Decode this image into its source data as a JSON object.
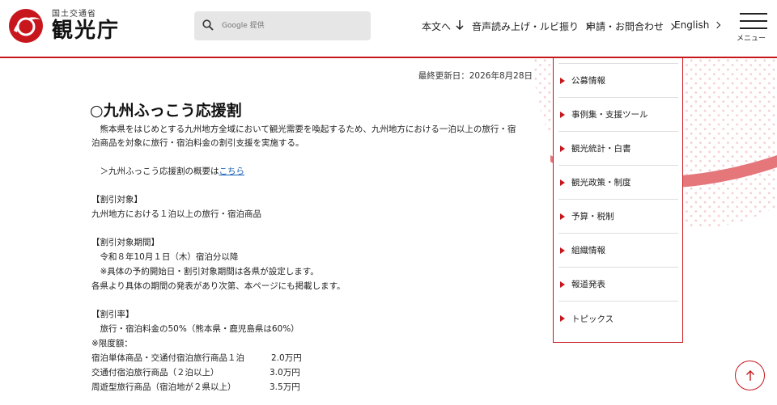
{
  "header": {
    "ministry": "国土交通省",
    "agency": "観光庁",
    "search_placeholder": "Google 提供",
    "nav": [
      {
        "label": "本文へ",
        "icon": "arrow-down-icon"
      },
      {
        "label": "音声読み上げ・ルビ振り",
        "icon": "chevron-right-icon"
      },
      {
        "label": "申請・お問合わせ",
        "icon": "chevron-right-icon"
      },
      {
        "label": "English",
        "icon": "chevron-right-icon"
      }
    ],
    "menu_label": "メニュー"
  },
  "main": {
    "updated": "最終更新日：2026年8月28日",
    "title": "○九州ふっこう応援割",
    "intro_line1": "　熊本県をはじめとする九州地方全域において観光需要を喚起するため、九州地方における一泊以上の旅行・宿",
    "intro_line2": "泊商品を対象に旅行・宿泊料金の割引支援を実施する。",
    "overview_prefix": "　＞九州ふっこう応援割の概要は",
    "overview_link": "こちら",
    "target_heading": "【割引対象】",
    "target_text": "九州地方における１泊以上の旅行・宿泊商品",
    "period_heading": "【割引対象期間】",
    "period_text": "　令和８年10月１日（木）宿泊分以降",
    "period_note": "　※具体の予約開始日・割引対象期間は各県が設定します。",
    "period_note2": "各県より具体の期間の発表があり次第、本ページにも掲載します。",
    "rate_heading": "【割引率】",
    "rate_text": "　旅行・宿泊料金の50%（熊本県・鹿児島県は60%）",
    "limit_heading": "※限度額：",
    "limits": [
      {
        "label": "宿泊単体商品・交通付宿泊旅行商品１泊",
        "value": "2.0万円"
      },
      {
        "label": "交通付宿泊旅行商品（２泊以上）",
        "value": "3.0万円"
      },
      {
        "label": "周遊型旅行商品（宿泊地が２県以上）",
        "value": "3.5万円"
      }
    ]
  },
  "side_menu": [
    "公募情報",
    "事例集・支援ツール",
    "観光統計・白書",
    "観光政策・制度",
    "予算・税制",
    "組織情報",
    "報道発表",
    "トピックス"
  ],
  "colors": {
    "accent": "#c8161d",
    "link": "#1a5fb4"
  }
}
